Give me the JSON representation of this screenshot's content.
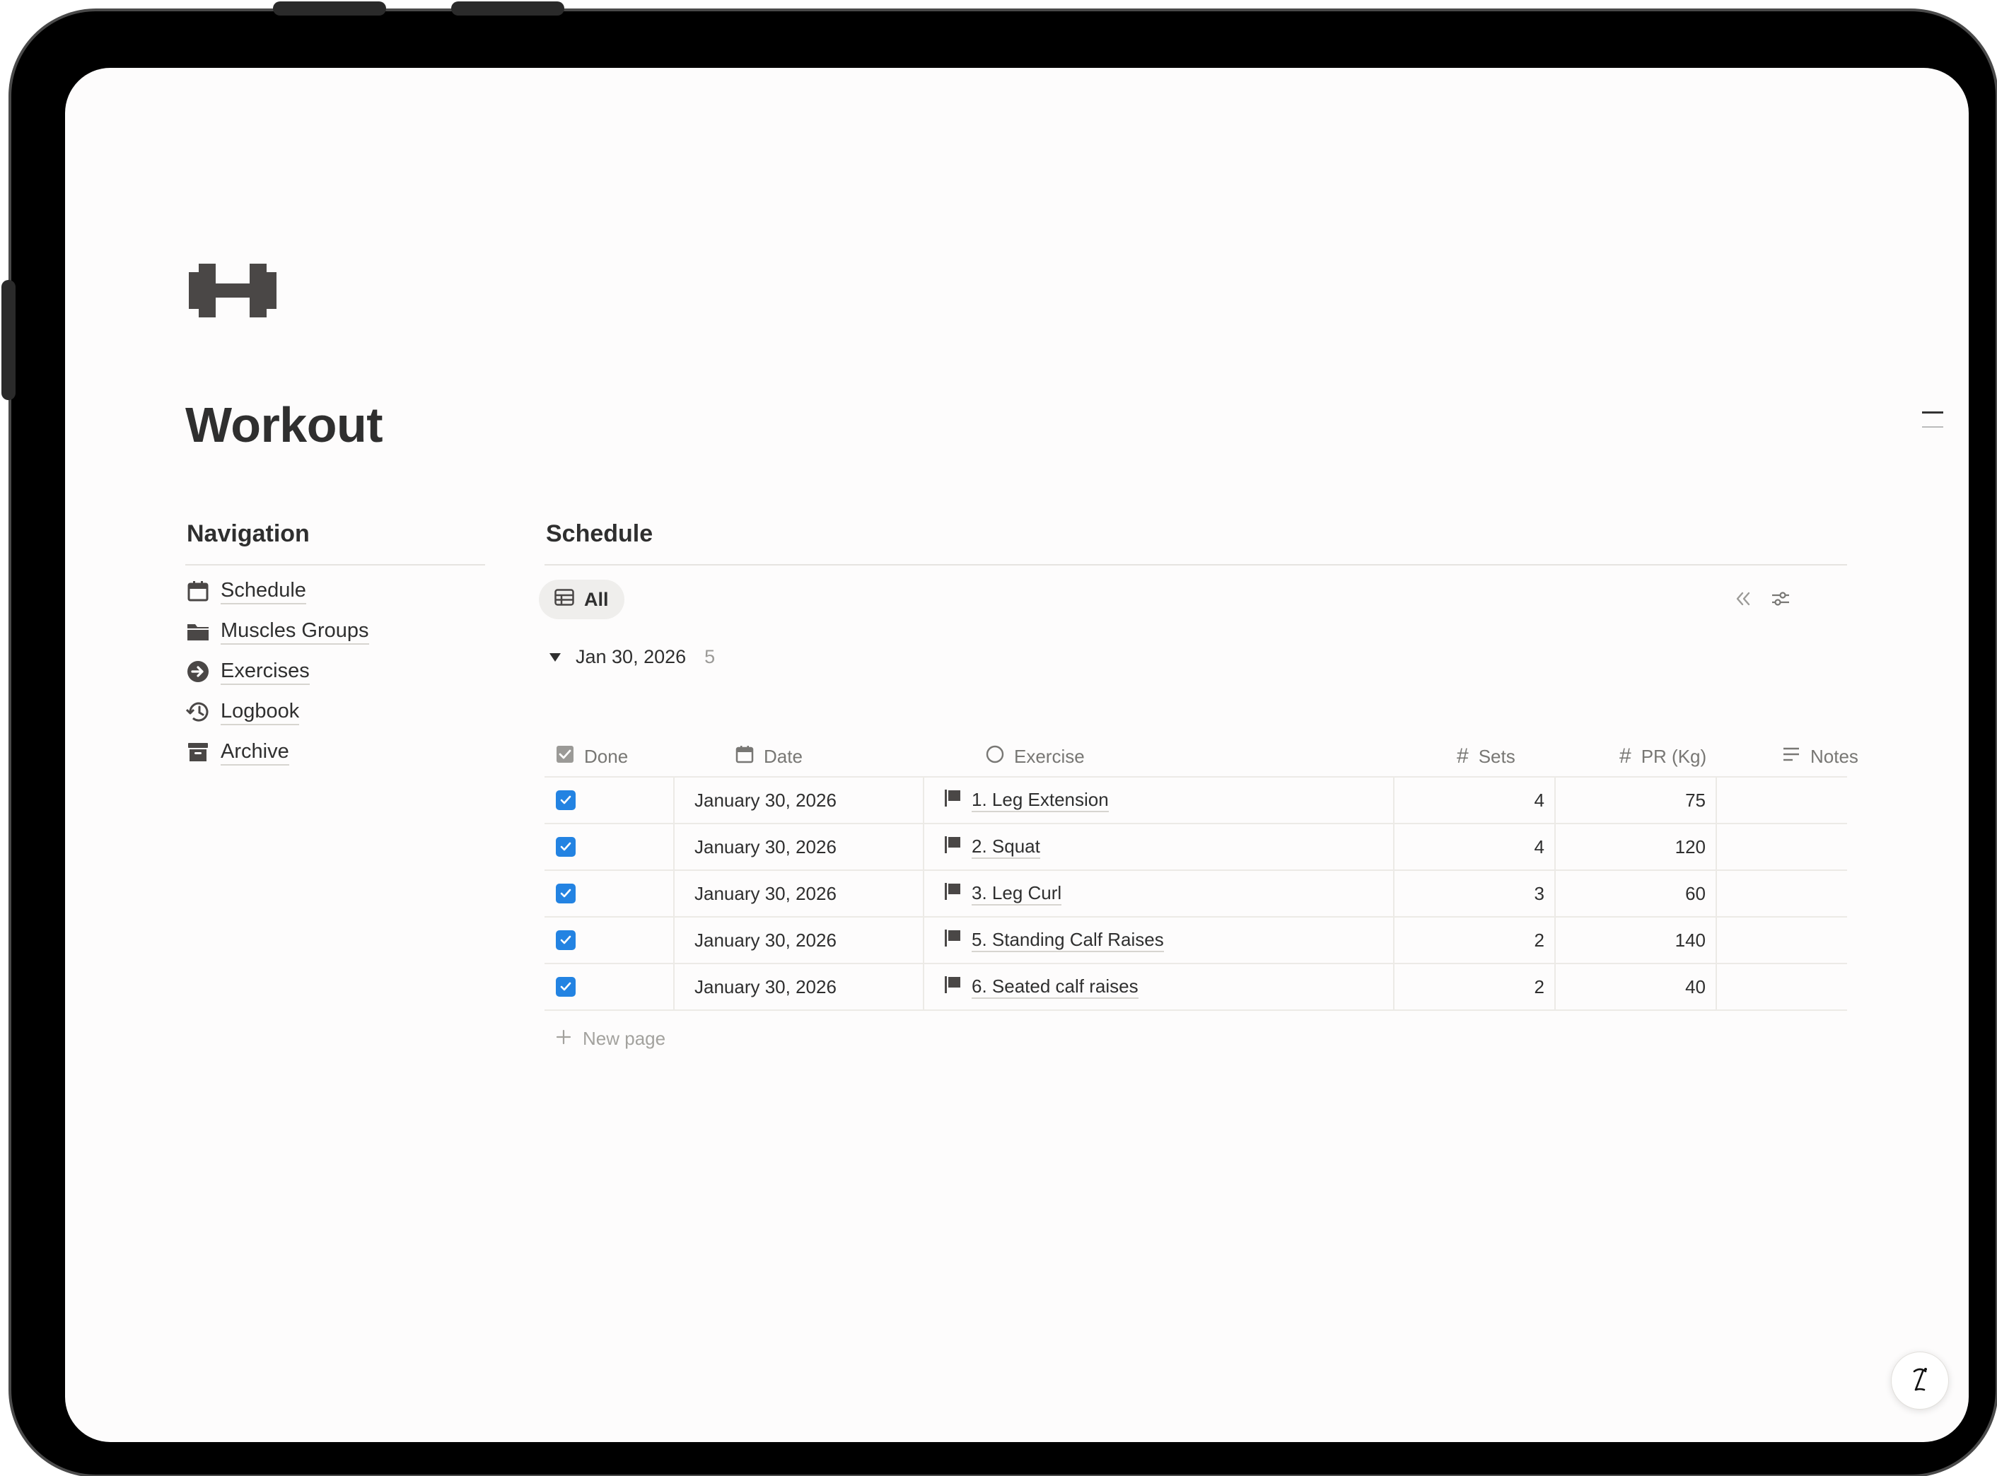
{
  "page": {
    "title": "Workout"
  },
  "navigation": {
    "heading": "Navigation",
    "items": [
      {
        "label": "Schedule",
        "icon": "calendar-icon"
      },
      {
        "label": "Muscles Groups",
        "icon": "folder-icon"
      },
      {
        "label": "Exercises",
        "icon": "arrow-circle-icon"
      },
      {
        "label": "Logbook",
        "icon": "history-icon"
      },
      {
        "label": "Archive",
        "icon": "archive-box-icon"
      }
    ]
  },
  "schedule": {
    "heading": "Schedule",
    "view_tab": "All",
    "group": {
      "label": "Jan 30, 2026",
      "count": "5"
    },
    "columns": {
      "done": "Done",
      "date": "Date",
      "exercise": "Exercise",
      "sets": "Sets",
      "pr": "PR (Kg)",
      "notes": "Notes"
    },
    "rows": [
      {
        "done": true,
        "date": "January 30, 2026",
        "exercise": "1. Leg Extension",
        "sets": "4",
        "pr": "75",
        "notes": ""
      },
      {
        "done": true,
        "date": "January 30, 2026",
        "exercise": "2. Squat",
        "sets": "4",
        "pr": "120",
        "notes": ""
      },
      {
        "done": true,
        "date": "January 30, 2026",
        "exercise": "3. Leg Curl",
        "sets": "3",
        "pr": "60",
        "notes": ""
      },
      {
        "done": true,
        "date": "January 30, 2026",
        "exercise": "5. Standing Calf Raises",
        "sets": "2",
        "pr": "140",
        "notes": ""
      },
      {
        "done": true,
        "date": "January 30, 2026",
        "exercise": "6. Seated calf raises",
        "sets": "2",
        "pr": "40",
        "notes": ""
      }
    ],
    "new_page": "New page"
  },
  "colors": {
    "checkbox_blue": "#2383e2",
    "text": "#2f2f2f",
    "muted": "#787774"
  }
}
